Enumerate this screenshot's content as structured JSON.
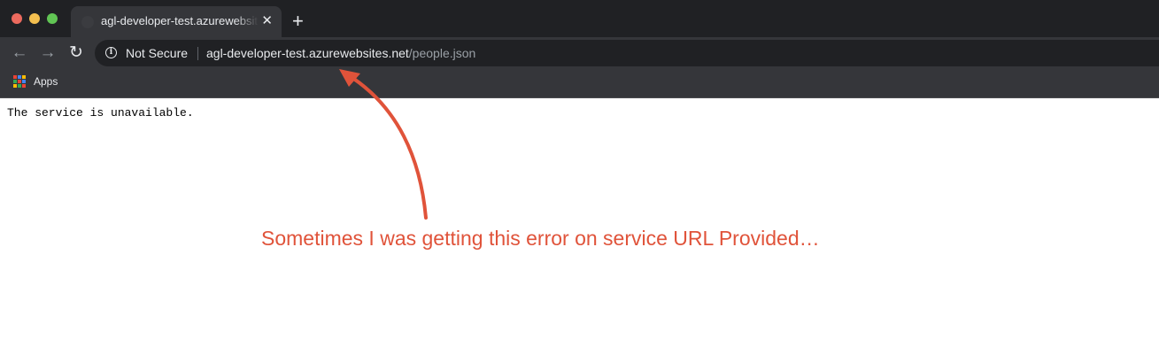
{
  "tab": {
    "title": "agl-developer-test.azurewebsites.net/people.json",
    "close_glyph": "✕"
  },
  "new_tab_glyph": "+",
  "nav": {
    "back_glyph": "←",
    "forward_glyph": "→",
    "reload_glyph": "↻"
  },
  "omnibox": {
    "info_glyph": "i",
    "security_label": "Not Secure",
    "url_host": "agl-developer-test.azurewebsites.net",
    "url_path": "/people.json"
  },
  "bookmarks": {
    "apps_label": "Apps",
    "apps_icon_colors": [
      "#ea4335",
      "#4285f4",
      "#fbbc05",
      "#34a853",
      "#ea4335",
      "#4285f4",
      "#fbbc05",
      "#34a853",
      "#ea4335"
    ]
  },
  "page": {
    "message": "The service is unavailable."
  },
  "annotation": {
    "text": "Sometimes I was getting this error on service URL Provided…",
    "color": "#e0533a"
  }
}
